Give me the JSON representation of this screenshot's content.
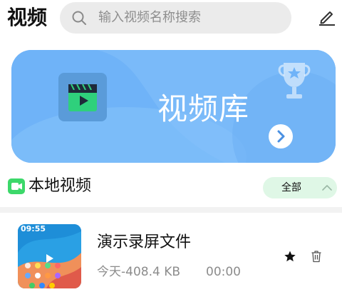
{
  "header": {
    "title": "视频",
    "search_placeholder": "输入视频名称搜索"
  },
  "banner": {
    "title": "视频库"
  },
  "section": {
    "title": "本地视频",
    "filter_label": "全部"
  },
  "video_list": [
    {
      "thumbnail_time": "09:55",
      "name": "演示录屏文件",
      "meta": "今天-408.4 KB",
      "duration": "00:00"
    }
  ],
  "colors": {
    "banner_bg": "#6fb3f8",
    "accent_green": "#3cd86a",
    "filter_bg": "#dff7e6"
  }
}
